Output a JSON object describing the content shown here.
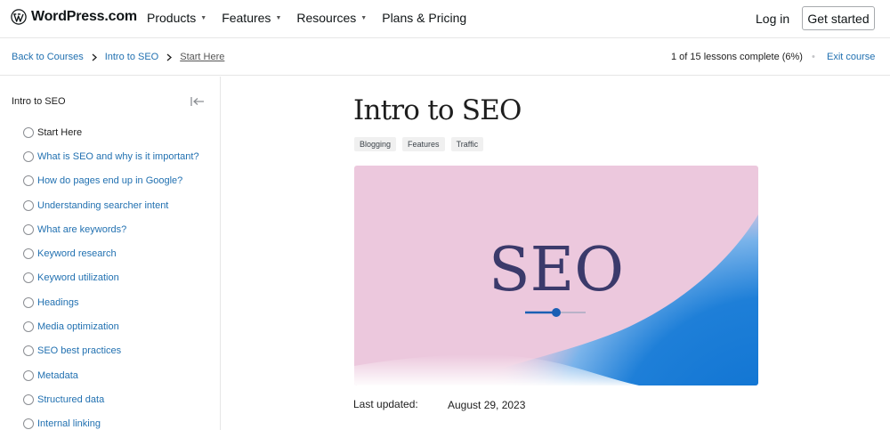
{
  "header": {
    "brand": "WordPress.com",
    "menu": [
      {
        "label": "Products",
        "has_dropdown": true
      },
      {
        "label": "Features",
        "has_dropdown": true
      },
      {
        "label": "Resources",
        "has_dropdown": true
      },
      {
        "label": "Plans & Pricing",
        "has_dropdown": false
      }
    ],
    "login": "Log in",
    "get_started": "Get started"
  },
  "breadcrumb": {
    "back": "Back to Courses",
    "course": "Intro to SEO",
    "current": "Start Here"
  },
  "progress": {
    "text": "1 of 15 lessons complete (6%)",
    "completed": 1,
    "total": 15,
    "separator": "•",
    "exit": "Exit course"
  },
  "sidebar": {
    "title": "Intro to SEO",
    "lessons": [
      {
        "label": "Start Here",
        "current": true
      },
      {
        "label": "What is SEO and why is it important?"
      },
      {
        "label": "How do pages end up in Google?"
      },
      {
        "label": "Understanding searcher intent"
      },
      {
        "label": "What are keywords?"
      },
      {
        "label": "Keyword research"
      },
      {
        "label": "Keyword utilization"
      },
      {
        "label": "Headings"
      },
      {
        "label": "Media optimization"
      },
      {
        "label": "SEO best practices"
      },
      {
        "label": "Metadata"
      },
      {
        "label": "Structured data"
      },
      {
        "label": "Internal linking"
      }
    ]
  },
  "main": {
    "title": "Intro to SEO",
    "tags": [
      "Blogging",
      "Features",
      "Traffic"
    ],
    "hero_text": "SEO",
    "last_updated_label": "Last updated:",
    "last_updated_value": "August 29, 2023"
  },
  "colors": {
    "link": "#2271b1",
    "hero_pink": "#ecc8dd",
    "hero_blue": "#0a6fd0",
    "hero_text": "#3b3a6b"
  }
}
